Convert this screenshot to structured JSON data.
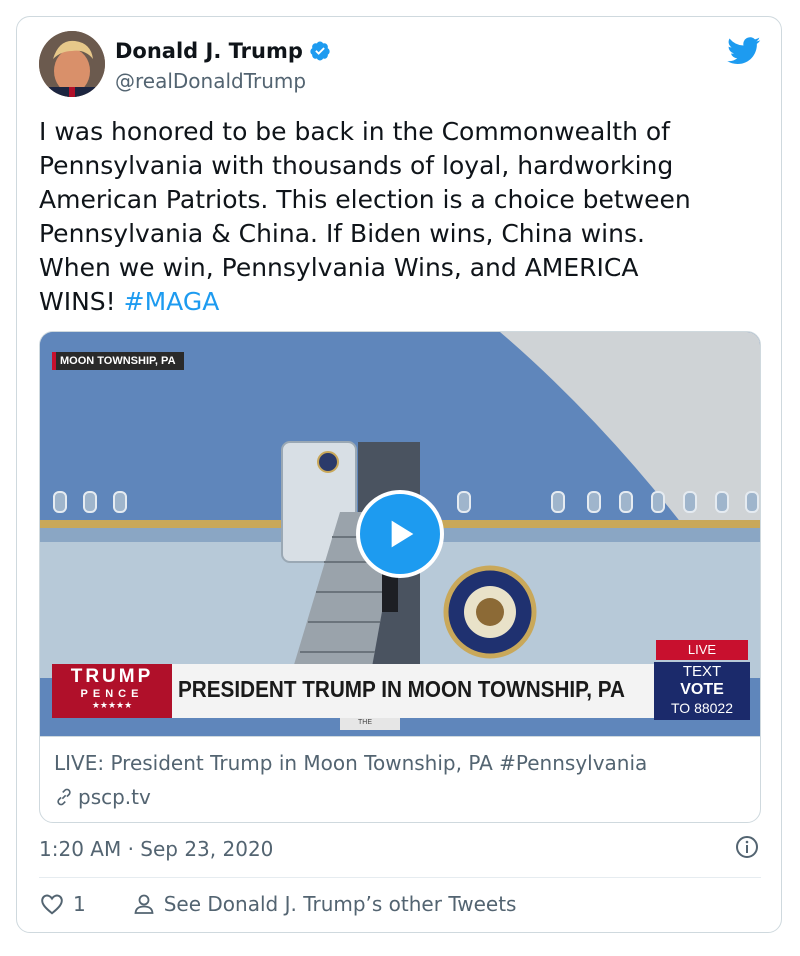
{
  "author": {
    "name": "Donald J. Trump",
    "handle": "@realDonaldTrump"
  },
  "tweet": {
    "text_lines": [
      "I was honored to be back in the Commonwealth of",
      "Pennsylvania with thousands of loyal, hardworking",
      "American Patriots. This election is a choice between",
      "Pennsylvania & China. If Biden wins, China wins.",
      "When we win, Pennsylvania Wins, and AMERICA"
    ],
    "last_line_text": "WINS!",
    "hashtag": "#MAGA",
    "timestamp": "1:20 AM · Sep 23, 2020"
  },
  "video": {
    "location_tag": "MOON TOWNSHIP, PA",
    "lower_third": "PRESIDENT TRUMP IN MOON TOWNSHIP, PA",
    "logo_top": "TRUMP",
    "logo_bottom": "PENCE",
    "logo_stars": "★★★★★",
    "live_label": "LIVE",
    "text_label": "TEXT",
    "vote_label": "VOTE",
    "to_number": "TO 88022",
    "small_caption": "THE"
  },
  "link_card": {
    "title": "LIVE: President Trump in Moon Township, PA #Pennsylvania",
    "url": "pscp.tv"
  },
  "actions": {
    "like_count": "1",
    "see_more": "See Donald J. Trump’s other Tweets"
  },
  "colors": {
    "accent": "#1d9bf0",
    "muted": "#536471",
    "plane_blue": "#5a81b5",
    "banner_red": "#c8102e",
    "banner_navy": "#1b2a6b"
  }
}
